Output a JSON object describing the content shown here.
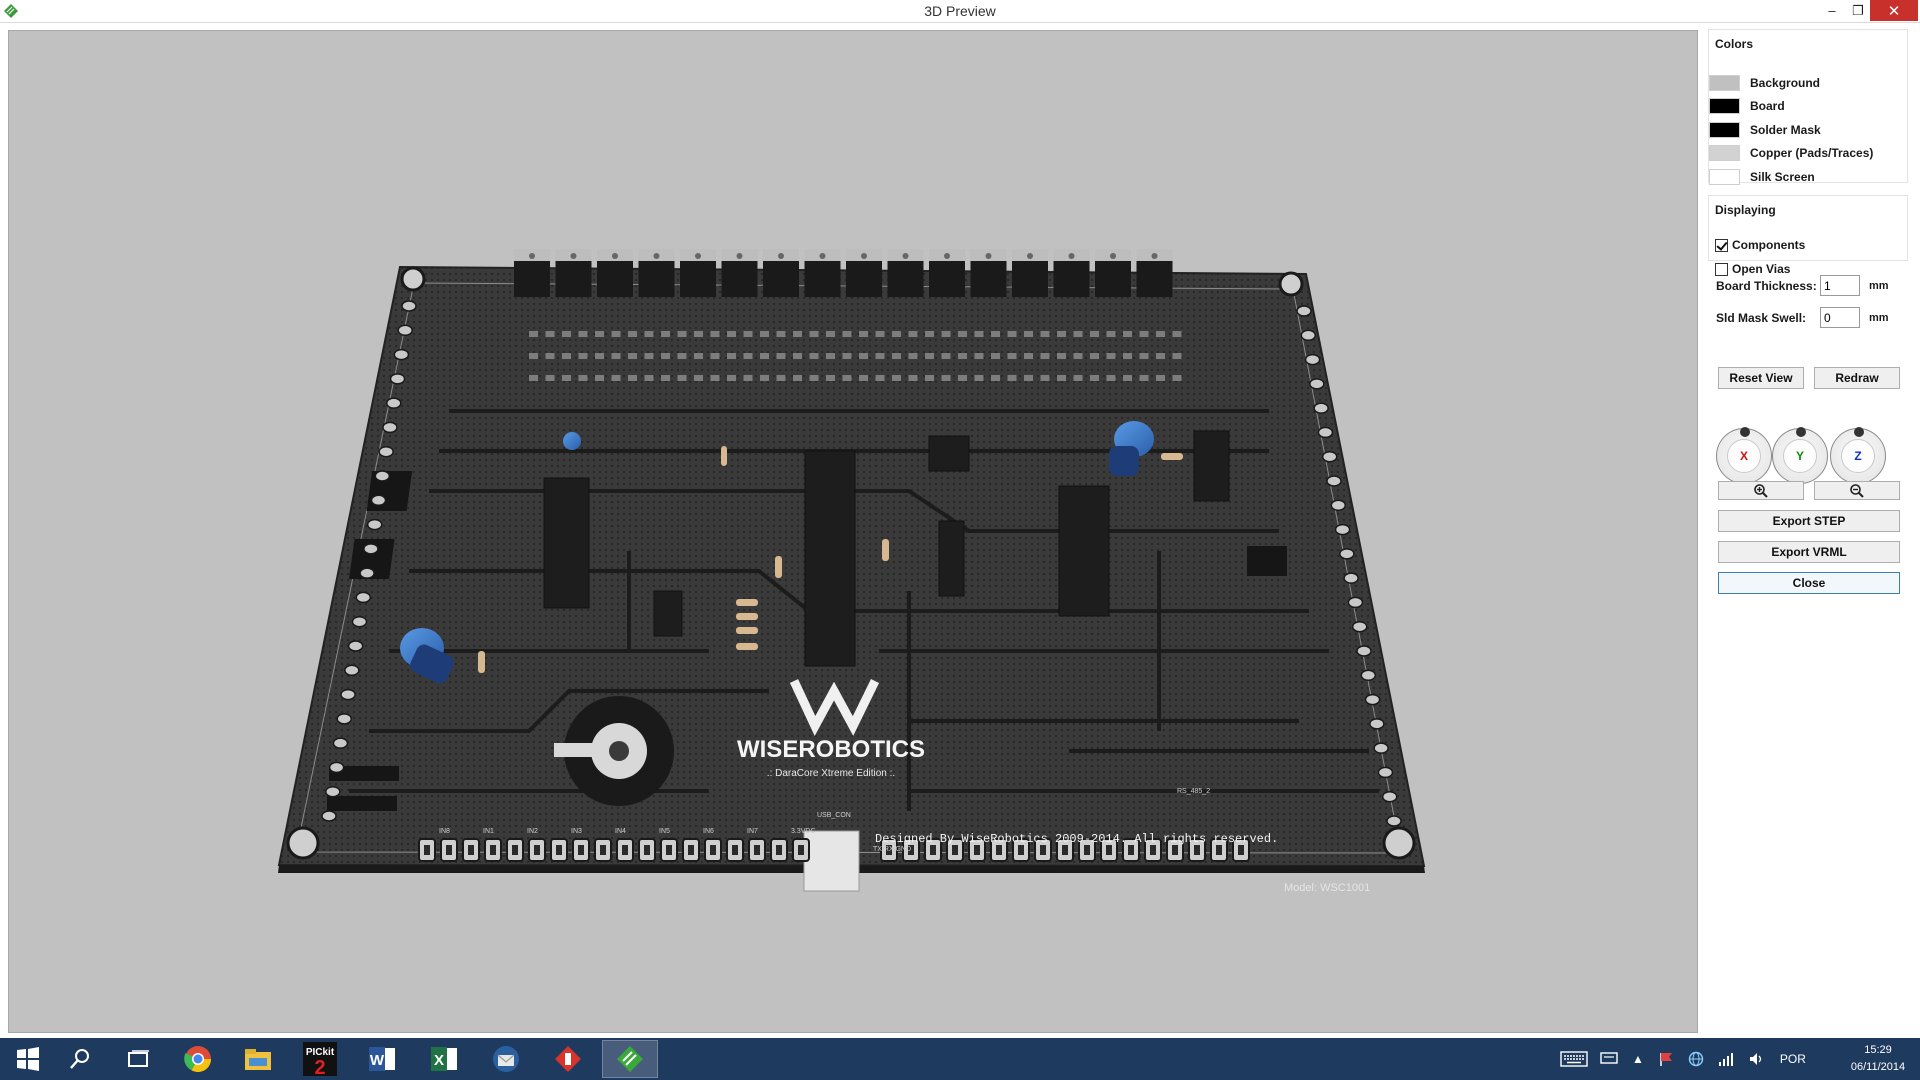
{
  "window": {
    "title": "3D Preview",
    "minimize_glyph": "–",
    "maximize_glyph": "❐",
    "close_glyph": "✕"
  },
  "viewport": {
    "background_color": "#c1c1c1",
    "board": {
      "logo_text": "WISEROBOTICS",
      "subtitle_text": ".: DaraCore Xtreme Edition :.",
      "credit_text": "Designed By WiseRobotics 2009-2014. All rights reserved.",
      "model_text": "Model: WSC1001",
      "usb_label": "USB_CON",
      "input_labels": [
        "IN8",
        "IN1",
        "IN2",
        "IN3",
        "IN4",
        "IN5",
        "IN6",
        "IN7",
        "3.3VDC"
      ],
      "rs485_label": "RS_485_2",
      "tx_label": "TX/RX/GND"
    }
  },
  "panel": {
    "colors": {
      "title": "Colors",
      "items": [
        {
          "label": "Background",
          "color": "#c0c0c0"
        },
        {
          "label": "Board",
          "color": "#000000"
        },
        {
          "label": "Solder Mask",
          "color": "#000000"
        },
        {
          "label": "Copper (Pads/Traces)",
          "color": "#d2d2d2"
        },
        {
          "label": "Silk Screen",
          "color": "#ffffff"
        }
      ]
    },
    "displaying": {
      "title": "Displaying",
      "components": {
        "label": "Components",
        "checked": true
      },
      "open_vias": {
        "label": "Open Vias",
        "checked": false
      }
    },
    "board_thickness": {
      "label": "Board Thickness:",
      "value": "1",
      "unit": "mm"
    },
    "sld_mask_swell": {
      "label": "Sld Mask Swell:",
      "value": "0",
      "unit": "mm"
    },
    "buttons": {
      "reset_view": "Reset View",
      "redraw": "Redraw",
      "export_step": "Export STEP",
      "export_vrml": "Export VRML",
      "close": "Close"
    },
    "dials": [
      {
        "label": "X",
        "color": "#d01010"
      },
      {
        "label": "Y",
        "color": "#108a10"
      },
      {
        "label": "Z",
        "color": "#1030c8"
      }
    ]
  },
  "taskbar": {
    "apps": [
      "start-icon",
      "search-icon",
      "task-view-icon",
      "chrome-icon",
      "file-explorer-icon",
      "pickit2-icon",
      "word-icon",
      "excel-icon",
      "thunderbird-icon",
      "app-red-icon",
      "pcb-app-icon"
    ],
    "pickit_label": "PICkit 2",
    "language": "POR",
    "time": "15:29",
    "date": "06/11/2014"
  }
}
